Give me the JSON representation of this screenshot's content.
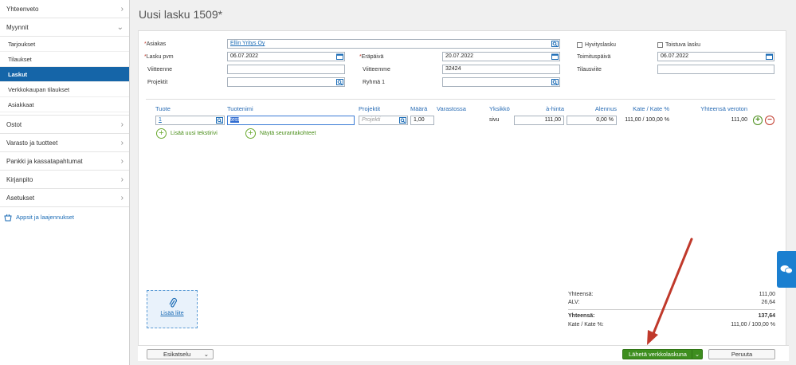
{
  "sidebar": {
    "top_item": "Yhteenveto",
    "sales_section": "Myynnit",
    "sales_items": [
      "Tarjoukset",
      "Tilaukset",
      "Laskut",
      "Verkkokaupan tilaukset",
      "Asiakkaat"
    ],
    "active_index": 2,
    "other_items": [
      "Ostot",
      "Varasto ja tuotteet",
      "Pankki ja kassatapahtumat",
      "Kirjanpito",
      "Asetukset"
    ],
    "apps_link": "Appsit ja laajennukset"
  },
  "page": {
    "title": "Uusi lasku 1509*"
  },
  "form": {
    "customer_label": "Asiakas",
    "customer_value": "Ellin Yritys Oy",
    "invoice_date_label": "Lasku pvm",
    "invoice_date_value": "06.07.2022",
    "due_date_label": "Eräpäivä",
    "due_date_value": "20.07.2022",
    "reference_label": "Viitteenne",
    "reference_value": "",
    "our_reference_label": "Viitteemme",
    "our_reference_value": "32424",
    "projects_label": "Projektit",
    "projects_value": "",
    "group_label": "Ryhmä 1",
    "group_value": "",
    "credit_note_label": "Hyvityslasku",
    "recurring_label": "Toistuva lasku",
    "delivery_date_label": "Toimituspäivä",
    "delivery_date_value": "06.07.2022",
    "order_ref_label": "Tilausviite",
    "order_ref_value": ""
  },
  "table": {
    "headers": {
      "product": "Tuote",
      "product_name": "Tuotenimi",
      "projects": "Projektit",
      "quantity": "Määrä",
      "in_stock": "Varastossa",
      "unit": "Yksikkö",
      "unit_price": "à-hinta",
      "discount": "Alennus",
      "margin": "Kate / Kate %",
      "total_ex_vat": "Yhteensä veroton"
    },
    "row": {
      "product": "1",
      "product_name": "test",
      "projects_placeholder": "Projekti",
      "quantity": "1,00",
      "unit": "sivu",
      "unit_price": "111,00",
      "discount": "0,00 %",
      "margin": "111,00 / 100,00 %",
      "total": "111,00"
    },
    "add_text_row": "Lisää uusi tekstirivi",
    "show_tracking": "Näytä seurantakohteet"
  },
  "attachment": {
    "label": "Lisää liite"
  },
  "totals": {
    "subtotal_label": "Yhteensä:",
    "subtotal_value": "111,00",
    "vat_label": "ALV:",
    "vat_value": "26,64",
    "total_label": "Yhteensä:",
    "total_value": "137,64",
    "margin_label": "Kate / Kate %:",
    "margin_value": "111,00 / 100,00 %"
  },
  "footer": {
    "preview": "Esikatselu",
    "send": "Lähetä verkkolaskuna",
    "cancel": "Peruuta"
  },
  "colors": {
    "accent": "#1565a8",
    "primary_action": "#3e8e1f",
    "annotation_arrow": "#c0392b"
  }
}
